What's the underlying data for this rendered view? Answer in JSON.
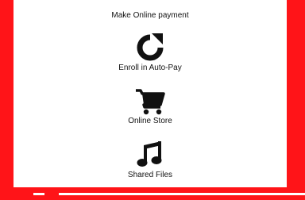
{
  "menu": {
    "items": [
      {
        "label": "Make Online payment",
        "icon": "credit-card-icon"
      },
      {
        "label": "Enroll in Auto-Pay",
        "icon": "refresh-icon"
      },
      {
        "label": "Online Store",
        "icon": "shopping-cart-icon"
      },
      {
        "label": "Shared Files",
        "icon": "music-note-icon"
      }
    ]
  },
  "colors": {
    "frame": "#ff1418",
    "panel": "#ffffff",
    "icon": "#111111",
    "text": "#111111"
  }
}
